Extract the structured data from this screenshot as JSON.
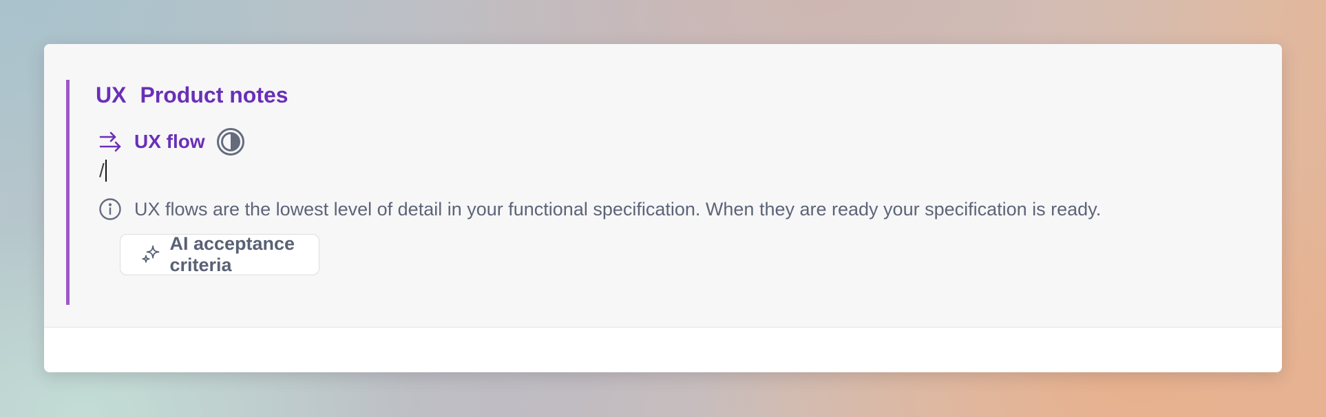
{
  "section": {
    "tag": "UX",
    "title": "Product notes",
    "accent_color": "#9b59c7",
    "title_color": "#6a2fb8"
  },
  "flow": {
    "icon": "arrows-right-icon",
    "label": "UX flow",
    "status_icon": "half-circle-status-icon"
  },
  "editor": {
    "value": "/"
  },
  "info": {
    "icon": "info-circle-icon",
    "text": "UX flows are the lowest level of detail in your functional specification. When they are ready your specification is ready."
  },
  "ai_button": {
    "icon": "sparkle-icon",
    "label": "AI acceptance criteria"
  }
}
